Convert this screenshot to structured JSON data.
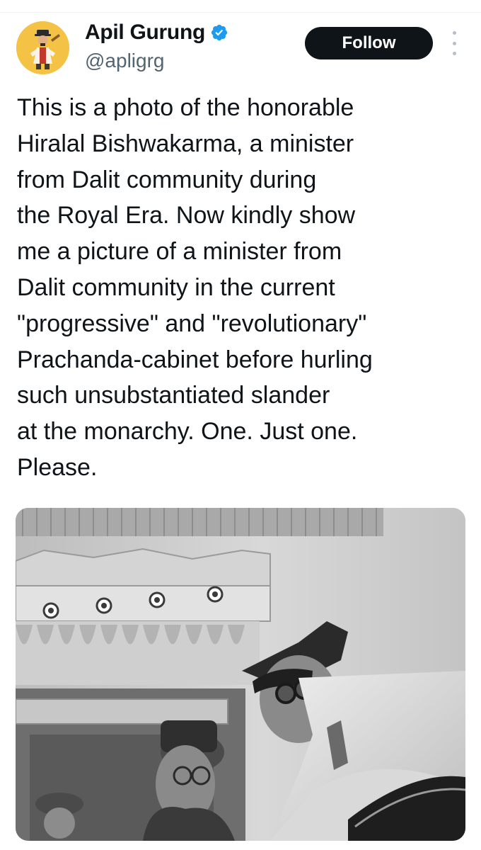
{
  "tweet": {
    "author": {
      "display_name": "Apil Gurung",
      "handle": "@apligrg",
      "verified": true,
      "avatar_icon": "avatar-illustration",
      "verified_icon": "verified-badge-icon",
      "badge_color": "#1d9bf0"
    },
    "follow_label": "Follow",
    "more_icon": "more-vertical-icon",
    "text": "This is a photo of the honorable\nHiralal Bishwakarma, a minister\nfrom Dalit community during\nthe Royal Era. Now kindly show\nme a picture of a minister from\nDalit community in the current\n\"progressive\" and \"revolutionary\"\nPrachanda-cabinet before hurling\nsuch unsubstantiated slander\nat the monarchy. One. Just one.\nPlease.",
    "media": {
      "type": "photo",
      "style": "black-and-white"
    }
  },
  "colors": {
    "text": "#0f1419",
    "secondary_text": "#536471",
    "follow_bg": "#0f1419",
    "follow_text": "#ffffff"
  }
}
